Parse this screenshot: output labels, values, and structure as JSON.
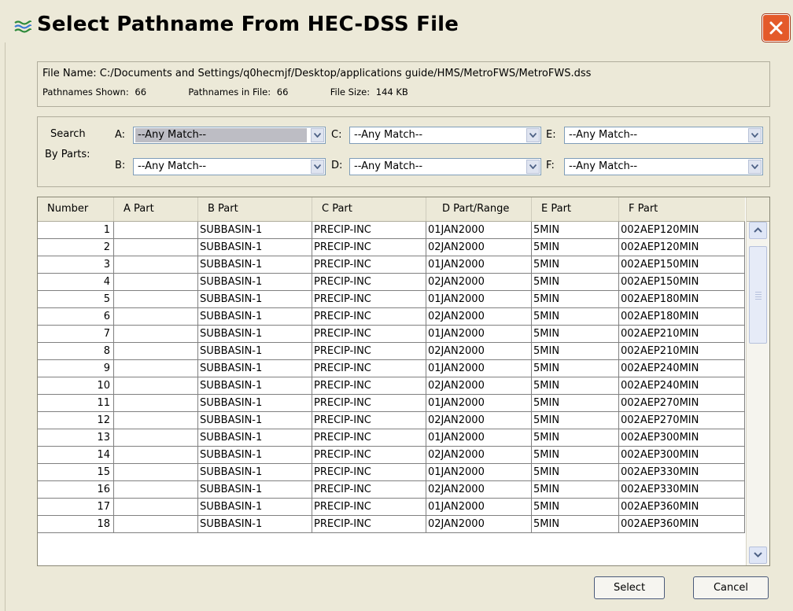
{
  "window": {
    "title": "Select Pathname From HEC-DSS File",
    "icon": "hec-dss-icon",
    "close_icon": "close-icon"
  },
  "info": {
    "file_name_label": "File Name:",
    "file_name": "C:/Documents and Settings/q0hecmjf/Desktop/applications guide/HMS/MetroFWS/MetroFWS.dss",
    "shown_label": "Pathnames Shown:",
    "shown": "66",
    "in_file_label": "Pathnames in File:",
    "in_file": "66",
    "size_label": "File Size:",
    "size": "144 KB"
  },
  "search": {
    "label1": "Search",
    "label2": "By Parts:",
    "parts": [
      {
        "label": "A:",
        "value": "--Any Match--"
      },
      {
        "label": "B:",
        "value": "--Any Match--"
      },
      {
        "label": "C:",
        "value": "--Any Match--"
      },
      {
        "label": "D:",
        "value": "--Any Match--"
      },
      {
        "label": "E:",
        "value": "--Any Match--"
      },
      {
        "label": "F:",
        "value": "--Any Match--"
      }
    ]
  },
  "table": {
    "columns": [
      "Number",
      "A Part",
      "B Part",
      "C Part",
      "D Part/Range",
      "E Part",
      "F Part"
    ],
    "rows": [
      [
        "1",
        "",
        "SUBBASIN-1",
        "PRECIP-INC",
        "01JAN2000",
        "5MIN",
        "002AEP120MIN"
      ],
      [
        "2",
        "",
        "SUBBASIN-1",
        "PRECIP-INC",
        "02JAN2000",
        "5MIN",
        "002AEP120MIN"
      ],
      [
        "3",
        "",
        "SUBBASIN-1",
        "PRECIP-INC",
        "01JAN2000",
        "5MIN",
        "002AEP150MIN"
      ],
      [
        "4",
        "",
        "SUBBASIN-1",
        "PRECIP-INC",
        "02JAN2000",
        "5MIN",
        "002AEP150MIN"
      ],
      [
        "5",
        "",
        "SUBBASIN-1",
        "PRECIP-INC",
        "01JAN2000",
        "5MIN",
        "002AEP180MIN"
      ],
      [
        "6",
        "",
        "SUBBASIN-1",
        "PRECIP-INC",
        "02JAN2000",
        "5MIN",
        "002AEP180MIN"
      ],
      [
        "7",
        "",
        "SUBBASIN-1",
        "PRECIP-INC",
        "01JAN2000",
        "5MIN",
        "002AEP210MIN"
      ],
      [
        "8",
        "",
        "SUBBASIN-1",
        "PRECIP-INC",
        "02JAN2000",
        "5MIN",
        "002AEP210MIN"
      ],
      [
        "9",
        "",
        "SUBBASIN-1",
        "PRECIP-INC",
        "01JAN2000",
        "5MIN",
        "002AEP240MIN"
      ],
      [
        "10",
        "",
        "SUBBASIN-1",
        "PRECIP-INC",
        "02JAN2000",
        "5MIN",
        "002AEP240MIN"
      ],
      [
        "11",
        "",
        "SUBBASIN-1",
        "PRECIP-INC",
        "01JAN2000",
        "5MIN",
        "002AEP270MIN"
      ],
      [
        "12",
        "",
        "SUBBASIN-1",
        "PRECIP-INC",
        "02JAN2000",
        "5MIN",
        "002AEP270MIN"
      ],
      [
        "13",
        "",
        "SUBBASIN-1",
        "PRECIP-INC",
        "01JAN2000",
        "5MIN",
        "002AEP300MIN"
      ],
      [
        "14",
        "",
        "SUBBASIN-1",
        "PRECIP-INC",
        "02JAN2000",
        "5MIN",
        "002AEP300MIN"
      ],
      [
        "15",
        "",
        "SUBBASIN-1",
        "PRECIP-INC",
        "01JAN2000",
        "5MIN",
        "002AEP330MIN"
      ],
      [
        "16",
        "",
        "SUBBASIN-1",
        "PRECIP-INC",
        "02JAN2000",
        "5MIN",
        "002AEP330MIN"
      ],
      [
        "17",
        "",
        "SUBBASIN-1",
        "PRECIP-INC",
        "01JAN2000",
        "5MIN",
        "002AEP360MIN"
      ],
      [
        "18",
        "",
        "SUBBASIN-1",
        "PRECIP-INC",
        "02JAN2000",
        "5MIN",
        "002AEP360MIN"
      ]
    ]
  },
  "buttons": {
    "select": "Select",
    "cancel": "Cancel"
  }
}
